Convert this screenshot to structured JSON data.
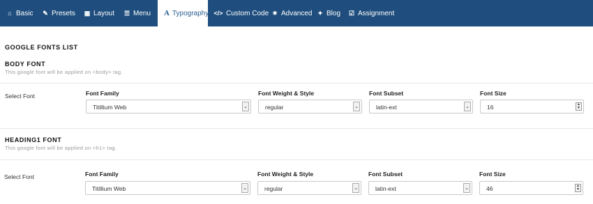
{
  "tabs": [
    {
      "label": "Basic",
      "icon": "home-icon",
      "glyph": "⌂"
    },
    {
      "label": "Presets",
      "icon": "brush-icon",
      "glyph": "✎"
    },
    {
      "label": "Layout",
      "icon": "layout-icon",
      "glyph": "▦"
    },
    {
      "label": "Menu",
      "icon": "list-icon",
      "glyph": "☰"
    },
    {
      "label": "Typography",
      "icon": "font-icon",
      "glyph": "A"
    },
    {
      "label": "Custom Code",
      "icon": "code-icon",
      "glyph": "</>"
    },
    {
      "label": "Advanced",
      "icon": "gear-icon",
      "glyph": "✷"
    },
    {
      "label": "Blog",
      "icon": "pin-icon",
      "glyph": "✦"
    },
    {
      "label": "Assignment",
      "icon": "checkbox-icon",
      "glyph": "☑"
    }
  ],
  "active_tab": "Typography",
  "colors": {
    "nav": "#1f4e7e",
    "active_tab_text": "#2a5d8f"
  },
  "page": {
    "title": "GOOGLE FONTS LIST"
  },
  "sections": [
    {
      "title": "BODY FONT",
      "desc": "This google font will be applied on <body> tag.",
      "row_label": "Select Font",
      "col_family": "Font Family",
      "col_weight": "Font Weight & Style",
      "col_subset": "Font Subset",
      "col_size": "Font Size",
      "family": "Titillium Web",
      "weight": "regular",
      "subset": "latin-ext",
      "size": "16"
    },
    {
      "title": "HEADING1 FONT",
      "desc": "This google font will be applied on <h1> tag.",
      "row_label": "Select Font",
      "col_family": "Font Family",
      "col_weight": "Font Weight & Style",
      "col_subset": "Font Subset",
      "col_size": "Font Size",
      "family": "Titillium Web",
      "weight": "regular",
      "subset": "latin-ext",
      "size": "46"
    }
  ]
}
